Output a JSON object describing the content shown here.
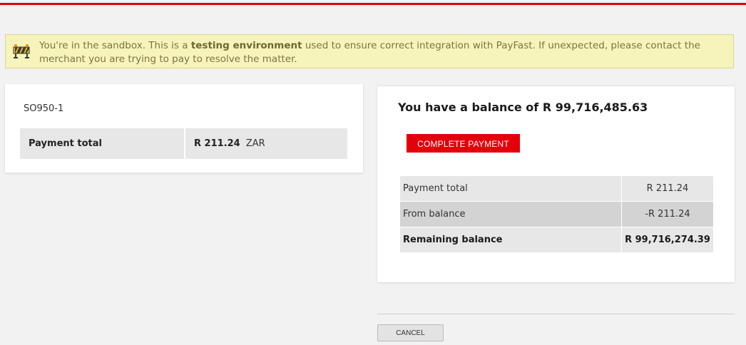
{
  "colors": {
    "accent": "#e4000b",
    "topbar": "#d8000c",
    "notice_bg": "#f6f4bb"
  },
  "notice": {
    "icon": "construction-barrier-icon",
    "text_before": "You're in the sandbox. This is a ",
    "text_bold": "testing environment",
    "text_after": " used to ensure correct integration with PayFast. If unexpected, please contact the merchant you are trying to pay to resolve the matter."
  },
  "order": {
    "reference": "SO950-1",
    "total_label": "Payment total",
    "total_amount": "R 211.24",
    "currency": "ZAR"
  },
  "balance": {
    "title": "You have a balance of R 99,716,485.63",
    "complete_button": "COMPLETE PAYMENT",
    "rows": [
      {
        "label": "Payment total",
        "value": "R 211.24"
      },
      {
        "label": "From balance",
        "value": "-R 211.24"
      },
      {
        "label": "Remaining balance",
        "value": "R 99,716,274.39"
      }
    ]
  },
  "footer": {
    "cancel_button": "CANCEL"
  }
}
